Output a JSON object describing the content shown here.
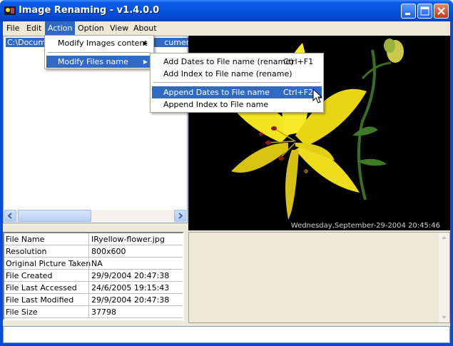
{
  "window": {
    "title": "Image Renaming - v1.4.0.0"
  },
  "menubar": [
    "File",
    "Edit",
    "Action",
    "Option",
    "View",
    "About"
  ],
  "left_pane": {
    "path_left": "C:\\Docume",
    "path_right": "cuments\\"
  },
  "action_menu": {
    "items": [
      "Modify Images content",
      "Modify Files name"
    ]
  },
  "files_submenu": {
    "items": [
      {
        "label": "Add Dates to File name (rename)",
        "shortcut": "Ctrl+F1"
      },
      {
        "label": "Add Index to File name (rename)",
        "shortcut": ""
      },
      {
        "label": "Append Dates to File name",
        "shortcut": "Ctrl+F2"
      },
      {
        "label": "Append Index to File name",
        "shortcut": ""
      }
    ]
  },
  "image": {
    "timestamp": "Wednesday,September-29-2004  20:45:46"
  },
  "info": [
    {
      "key": "File Name",
      "value": "IRyellow-flower.jpg"
    },
    {
      "key": "Resolution",
      "value": "800x600"
    },
    {
      "key": "Original Picture Taken",
      "value": "NA"
    },
    {
      "key": "File Created",
      "value": "29/9/2004 20:47:38"
    },
    {
      "key": "File Last Accessed",
      "value": "24/6/2005 19:15:43"
    },
    {
      "key": "File Last Modified",
      "value": "29/9/2004 20:47:38"
    },
    {
      "key": "File Size",
      "value": "37798"
    }
  ]
}
